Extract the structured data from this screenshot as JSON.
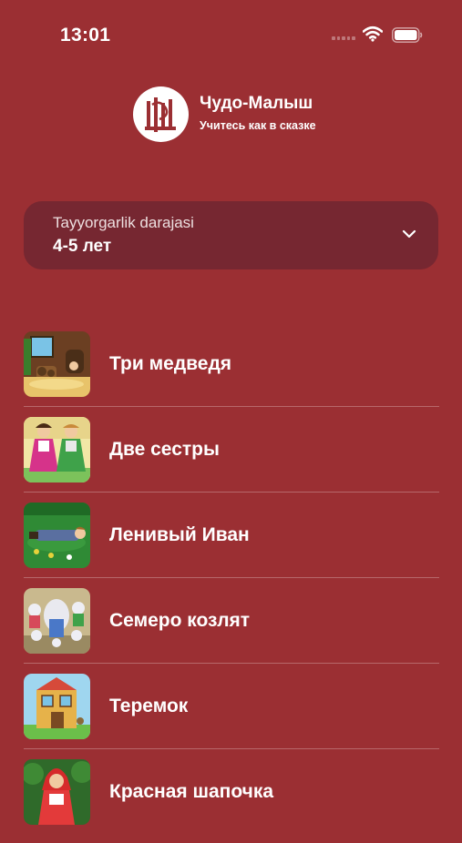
{
  "status_bar": {
    "time": "13:01"
  },
  "brand": {
    "name": "Чудо-Малыш",
    "tagline": "Учитесь как в сказке"
  },
  "level_select": {
    "label": "Tayyorgarlik darajasi",
    "value": "4-5 лет"
  },
  "stories": [
    {
      "title": "Три медведя"
    },
    {
      "title": "Две сестры"
    },
    {
      "title": "Ленивый Иван"
    },
    {
      "title": "Семеро козлят"
    },
    {
      "title": "Теремок"
    },
    {
      "title": "Красная шапочка"
    }
  ],
  "colors": {
    "background": "#9b2f33",
    "select_background": "#762731",
    "text": "#ffffff"
  }
}
